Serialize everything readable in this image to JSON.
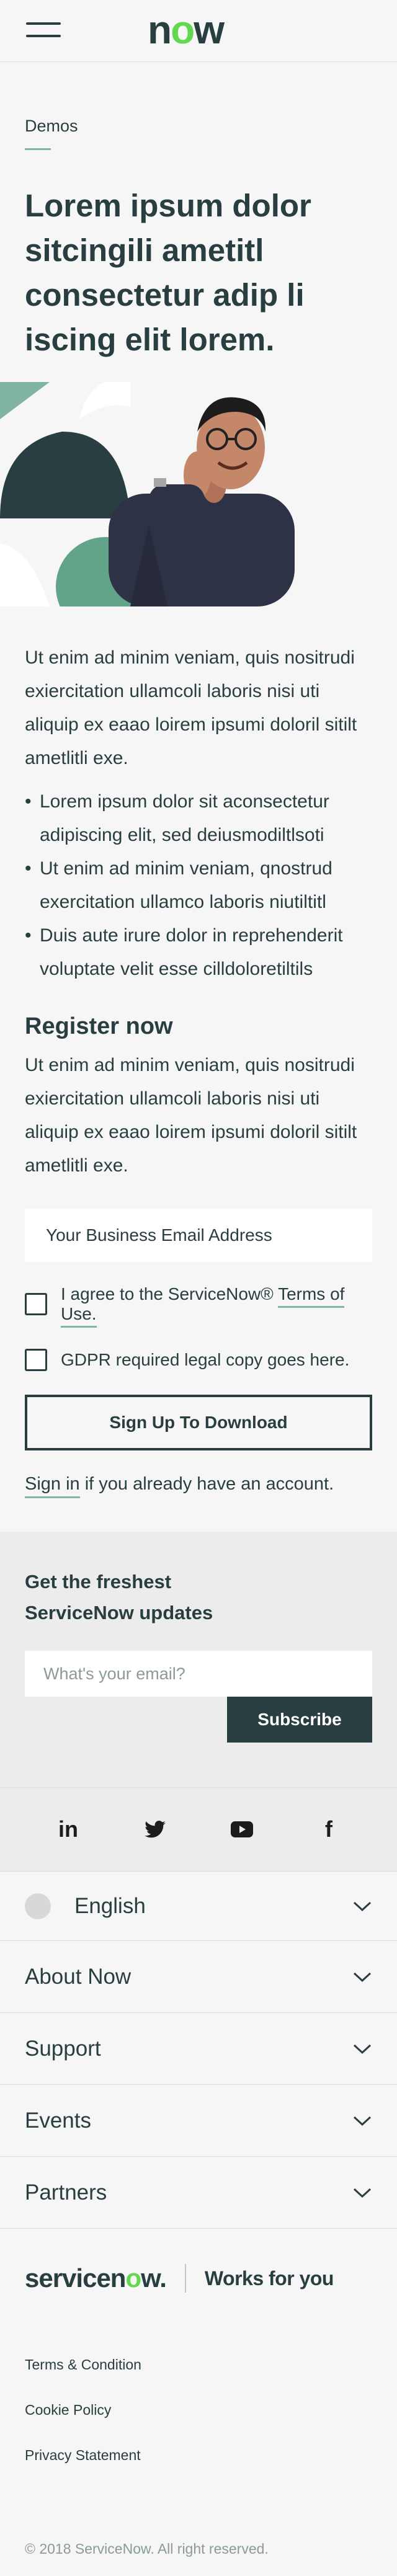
{
  "header": {
    "logo_text_n": "n",
    "logo_text_o": "o",
    "logo_text_w": "w"
  },
  "page": {
    "eyebrow": "Demos",
    "headline": "Lorem ipsum dolor sitcingili ametitl consectetur adip li iscing elit lorem.",
    "intro": "Ut enim ad minim veniam, quis nositrudi exiercitation ullamcoli laboris nisi uti aliquip ex eaao loirem ipsumi doloril sitilt ametlitli exe.",
    "bullets": [
      "Lorem ipsum dolor sit aconsectetur adipiscing elit, sed deiusmodiltlsoti",
      "Ut enim ad minim veniam, qnostrud exercitation ullamco laboris niutiltitl",
      "Duis aute irure dolor in reprehenderit voluptate velit esse cilldoloretiltils"
    ]
  },
  "register": {
    "title": "Register now",
    "text": "Ut enim ad minim veniam, quis nositrudi exiercitation ullamcoli laboris nisi uti aliquip ex eaao loirem ipsumi doloril sitilt ametlitli exe.",
    "email_placeholder": "Your Business Email Address",
    "terms_prefix": "I agree to the ServiceNow® ",
    "terms_link": "Terms of Use.",
    "gdpr_label": "GDPR required legal copy goes here.",
    "submit_label": "Sign Up To Download",
    "signin_link": "Sign in",
    "signin_suffix": " if you already have an account."
  },
  "newsletter": {
    "title_line1": "Get the freshest",
    "title_line2": "ServiceNow updates",
    "email_placeholder": "What's your email?",
    "button_label": "Subscribe"
  },
  "social": {
    "icons": [
      "linkedin-icon",
      "twitter-icon",
      "youtube-icon",
      "facebook-icon"
    ],
    "linkedin_text": "in",
    "facebook_text": "f"
  },
  "accordion": {
    "language": "English",
    "items": [
      "About Now",
      "Support",
      "Events",
      "Partners"
    ]
  },
  "footer": {
    "brand_part1": "servicen",
    "brand_o": "o",
    "brand_part2": "w.",
    "tagline": "Works for you",
    "links": [
      "Terms & Condition",
      "Cookie Policy",
      "Privacy Statement"
    ],
    "copyright": "© 2018 ServiceNow. All right reserved."
  },
  "colors": {
    "primary": "#293e40",
    "accent_green": "#62d84e",
    "muted_green": "#81b5a1",
    "background": "#f6f6f6"
  }
}
